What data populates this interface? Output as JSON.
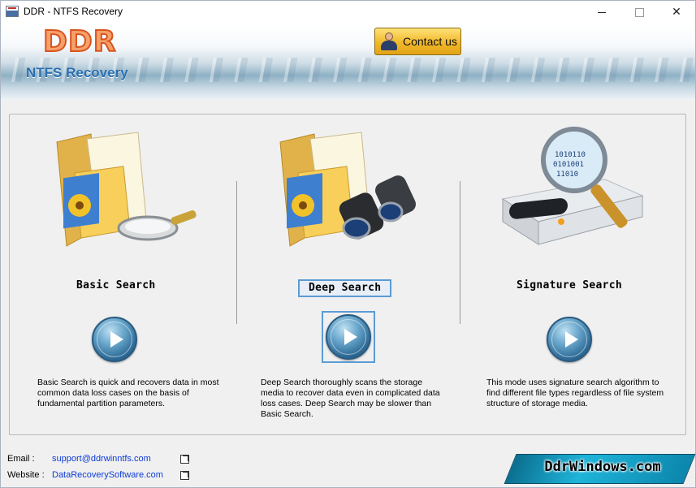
{
  "window": {
    "title": "DDR - NTFS Recovery"
  },
  "header": {
    "logo": "DDR",
    "subtitle": "NTFS Recovery",
    "contact_label": "Contact us"
  },
  "modes": [
    {
      "title": "Basic Search",
      "selected": false,
      "description": "Basic Search is quick and recovers data in most common data loss cases on the basis of fundamental partition parameters."
    },
    {
      "title": "Deep Search",
      "selected": true,
      "description": "Deep Search thoroughly scans the storage media to recover data even in complicated data loss cases. Deep Search may be slower than Basic Search."
    },
    {
      "title": "Signature Search",
      "selected": false,
      "description": "This mode uses signature search algorithm to find different file types regardless of file system structure of storage media."
    }
  ],
  "footer": {
    "email_label": "Email :",
    "email": "support@ddrwinntfs.com",
    "website_label": "Website :",
    "website": "DataRecoverySoftware.com",
    "brand": "DdrWindows.com"
  },
  "colors": {
    "accent": "#5b9bd5",
    "logo": "#d9541e",
    "subtitle": "#2b6fb0",
    "link": "#0b3bd6"
  }
}
